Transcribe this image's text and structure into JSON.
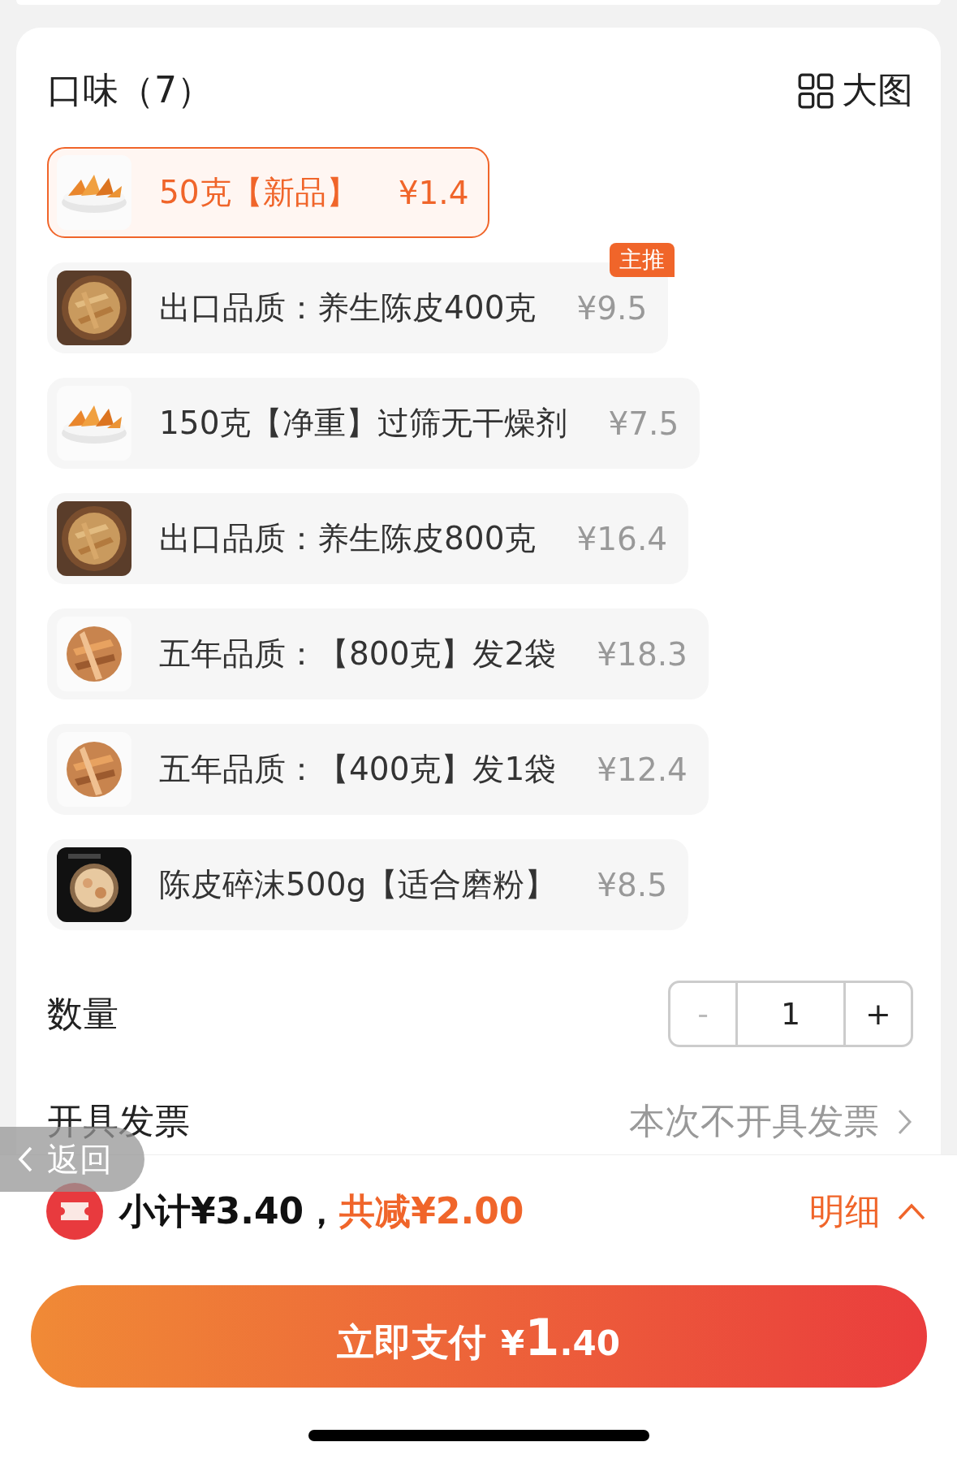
{
  "section": {
    "title": "口味（7）",
    "view_toggle": "大图"
  },
  "options": [
    {
      "name": "50克【新品】",
      "price": "¥1.4",
      "selected": true
    },
    {
      "name": "出口品质：养生陈皮400克",
      "price": "¥9.5",
      "selected": false,
      "badge": "主推"
    },
    {
      "name": "150克【净重】过筛无干燥剂",
      "price": "¥7.5",
      "selected": false
    },
    {
      "name": "出口品质：养生陈皮800克",
      "price": "¥16.4",
      "selected": false
    },
    {
      "name": "五年品质：【800克】发2袋",
      "price": "¥18.3",
      "selected": false
    },
    {
      "name": "五年品质：【400克】发1袋",
      "price": "¥12.4",
      "selected": false
    },
    {
      "name": "陈皮碎沫500g【适合磨粉】",
      "price": "¥8.5",
      "selected": false
    }
  ],
  "quantity": {
    "label": "数量",
    "minus": "-",
    "value": "1",
    "plus": "+",
    "minus_disabled": true
  },
  "invoice": {
    "label": "开具发票",
    "value": "本次不开具发票"
  },
  "back_button": "返回",
  "summary": {
    "subtotal": "小计¥3.40，",
    "discount": "共减¥2.00",
    "details": "明细"
  },
  "pay_button": {
    "label": "立即支付",
    "currency": "¥",
    "amount_int": "1",
    "amount_dec": ".40"
  }
}
